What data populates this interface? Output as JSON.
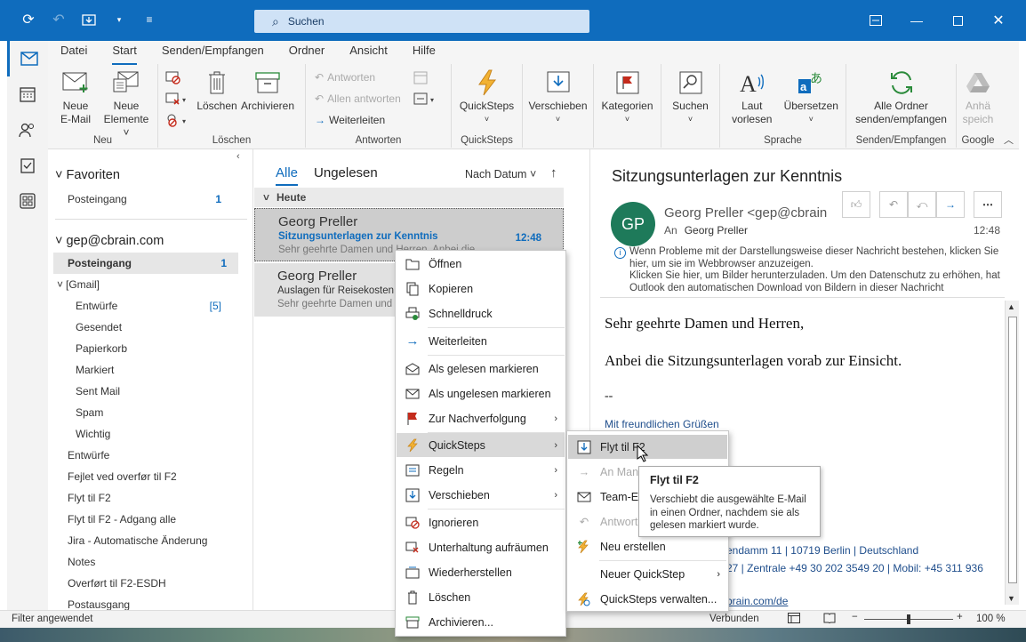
{
  "titlebar": {
    "search_placeholder": "Suchen",
    "accent": "#0f6cbd"
  },
  "ribbon": {
    "tabs": [
      "Datei",
      "Start",
      "Senden/Empfangen",
      "Ordner",
      "Ansicht",
      "Hilfe"
    ],
    "groups": {
      "neu": {
        "label": "Neu",
        "new_email": "Neue\nE-Mail",
        "new_items": "Neue\nElemente ˅"
      },
      "loeschen": {
        "label": "Löschen",
        "delete": "Löschen",
        "archive": "Archivieren"
      },
      "antworten": {
        "label": "Antworten",
        "reply": "Antworten",
        "reply_all": "Allen antworten",
        "forward": "Weiterleiten"
      },
      "quicksteps": {
        "label": "QuickSteps",
        "btn": "QuickSteps"
      },
      "verschieben": {
        "btn": "Verschieben"
      },
      "kategorien": {
        "btn": "Kategorien"
      },
      "suchen": {
        "btn": "Suchen"
      },
      "sprache": {
        "label": "Sprache",
        "read_aloud": "Laut\nvorlesen",
        "translate": "Übersetzen"
      },
      "sendrecv": {
        "label": "Senden/Empfangen",
        "btn": "Alle Ordner\nsenden/empfangen"
      },
      "google": {
        "label": "Google",
        "btn": "Anhä\nspeich"
      }
    }
  },
  "folders": {
    "favorites_header": "Favoriten",
    "fav_inbox": "Posteingang",
    "fav_inbox_count": "1",
    "account": "gep@cbrain.com",
    "inbox": "Posteingang",
    "inbox_count": "1",
    "gmail": "[Gmail]",
    "gmail_items": [
      {
        "label": "Entwürfe",
        "count": "[5]"
      },
      {
        "label": "Gesendet"
      },
      {
        "label": "Papierkorb"
      },
      {
        "label": "Markiert"
      },
      {
        "label": "Sent Mail"
      },
      {
        "label": "Spam"
      },
      {
        "label": "Wichtig"
      }
    ],
    "other_items": [
      "Entwürfe",
      "Fejlet ved overfør til F2",
      "Flyt til F2",
      "Flyt til F2 - Adgang alle",
      "Jira - Automatische Änderung",
      "Notes",
      "Overført til F2-ESDH",
      "Postausgang"
    ]
  },
  "message_list": {
    "tab_all": "Alle",
    "tab_unread": "Ungelesen",
    "sort_by": "Nach Datum",
    "group_today": "Heute",
    "messages": [
      {
        "from": "Georg Preller",
        "subject": "Sitzungsunterlagen zur Kenntnis",
        "preview": "Sehr geehrte Damen und Herren,  Anbei die",
        "time": "12:48"
      },
      {
        "from": "Georg Preller",
        "subject": "Auslagen für Reisekosten",
        "preview": "Sehr geehrte Damen und"
      }
    ]
  },
  "reading": {
    "subject": "Sitzungsunterlagen zur Kenntnis",
    "avatar_initials": "GP",
    "sender": "Georg Preller <gep@cbrain",
    "to_label": "An",
    "to_name": "Georg Preller",
    "time": "12:48",
    "info_1": "Wenn Probleme mit der Darstellungsweise dieser Nachricht bestehen, klicken Sie hier, um sie im Webbrowser anzuzeigen.",
    "info_2": "Klicken Sie hier, um Bilder herunterzuladen. Um den Datenschutz zu erhöhen, hat Outlook den automatischen Download von Bildern in dieser Nachricht",
    "body_1": "Sehr geehrte Damen und Herren,",
    "body_2": "Anbei die Sitzungsunterlagen vorab zur Einsicht.",
    "body_3": "--",
    "sig_greeting": "Mit freundlichen Grüßen",
    "sig_address": "endamm 11 | 10719 Berlin | Deutschland",
    "sig_phone": "27 | Zentrale +49 30 202 3549 20 | Mobil: +45 311 936",
    "sig_web": "brain.com/de"
  },
  "context_menu": {
    "items": [
      {
        "label": "Öffnen"
      },
      {
        "label": "Kopieren"
      },
      {
        "label": "Schnelldruck"
      },
      {
        "label": "Weiterleiten"
      },
      {
        "label": "Als gelesen markieren"
      },
      {
        "label": "Als ungelesen markieren"
      },
      {
        "label": "Zur Nachverfolgung"
      },
      {
        "label": "QuickSteps"
      },
      {
        "label": "Regeln"
      },
      {
        "label": "Verschieben"
      },
      {
        "label": "Ignorieren"
      },
      {
        "label": "Unterhaltung aufräumen"
      },
      {
        "label": "Wiederherstellen"
      },
      {
        "label": "Löschen"
      },
      {
        "label": "Archivieren..."
      }
    ]
  },
  "quicksteps_menu": {
    "items": [
      {
        "label": "Flyt til F2"
      },
      {
        "label": "An Mana"
      },
      {
        "label": "Team-E"
      },
      {
        "label": "Antwort"
      },
      {
        "label": "Neu erstellen"
      },
      {
        "label": "Neuer QuickStep"
      },
      {
        "label": "QuickSteps verwalten..."
      }
    ]
  },
  "tooltip": {
    "title": "Flyt til F2",
    "text": "Verschiebt die ausgewählte E-Mail in einen Ordner, nachdem sie als gelesen markiert wurde."
  },
  "statusbar": {
    "filter": "Filter angewendet",
    "connection": "Verbunden",
    "zoom": "100 %",
    "zoom_level": 0.5
  }
}
